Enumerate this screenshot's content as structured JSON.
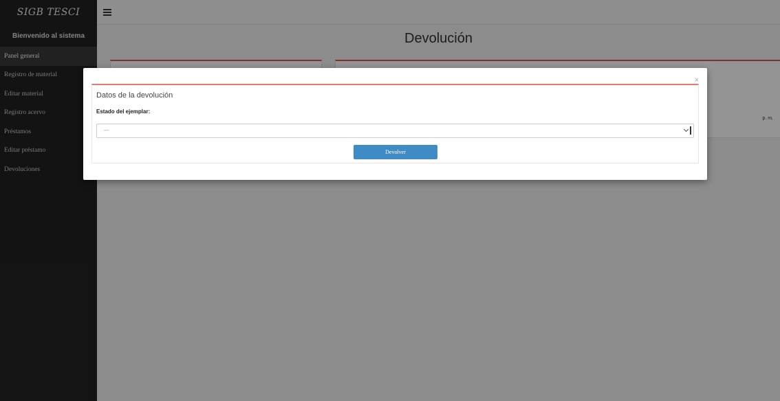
{
  "sidebar": {
    "brand": "SIGB TESCI",
    "welcome": "Bienvenido al sistema",
    "items": [
      {
        "label": "Panel general"
      },
      {
        "label": "Registro de material"
      },
      {
        "label": "Editar material"
      },
      {
        "label": "Registro acervo"
      },
      {
        "label": "Préstamos"
      },
      {
        "label": "Editar préstamo"
      },
      {
        "label": "Devoluciones"
      }
    ]
  },
  "main": {
    "title": "Devolución",
    "card_partial_text": "p. m."
  },
  "modal": {
    "close": "×",
    "heading": "Datos de la devolución",
    "field_label": "Estado del ejemplar:",
    "select_value": "---",
    "submit_label": "Devolver"
  },
  "colors": {
    "sidebar_bg": "#222222",
    "accent_red": "#d9534f",
    "button_blue": "#3f8bc5"
  }
}
